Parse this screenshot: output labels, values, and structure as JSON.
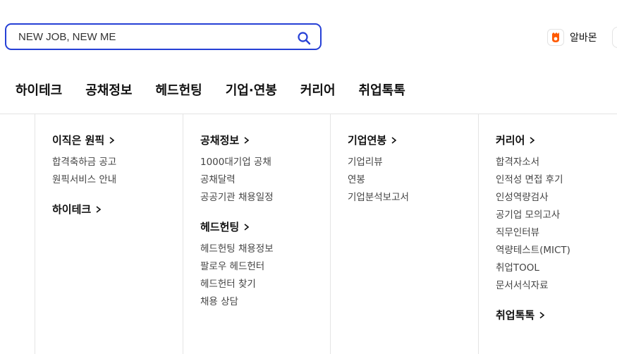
{
  "search": {
    "placeholder": "NEW JOB, NEW ME"
  },
  "brand": {
    "label": "알바몬"
  },
  "nav": [
    "하이테크",
    "공채정보",
    "헤드헌팅",
    "기업·연봉",
    "커리어",
    "취업톡톡"
  ],
  "columns": [
    {
      "sections": [
        {
          "title": "이직은 원픽",
          "links": [
            "합격축하금 공고",
            "원픽서비스 안내"
          ]
        },
        {
          "title": "하이테크",
          "links": []
        }
      ]
    },
    {
      "sections": [
        {
          "title": "공채정보",
          "links": [
            "1000대기업 공채",
            "공채달력",
            "공공기관 채용일정"
          ]
        },
        {
          "title": "헤드헌팅",
          "links": [
            "헤드헌팅 채용정보",
            "팔로우 헤드헌터",
            "헤드헌터 찾기",
            "채용 상담"
          ]
        }
      ]
    },
    {
      "sections": [
        {
          "title": "기업연봉",
          "links": [
            "기업리뷰",
            "연봉",
            "기업분석보고서"
          ]
        }
      ]
    },
    {
      "sections": [
        {
          "title": "커리어",
          "links": [
            "합격자소서",
            "인적성 면접 후기",
            "인성역량검사",
            "공기업 모의고사",
            "직무인터뷰",
            "역량테스트(MICT)",
            "취업TOOL",
            "문서서식자료"
          ]
        },
        {
          "title": "취업톡톡",
          "links": []
        }
      ]
    }
  ],
  "colors": {
    "accent": "#2640d6",
    "brand_orange": "#ff5a00"
  }
}
